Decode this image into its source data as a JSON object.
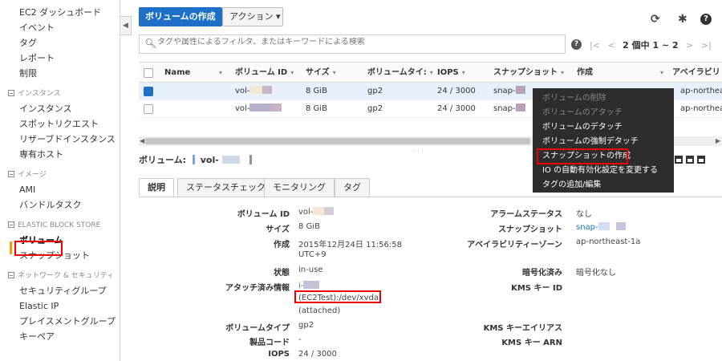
{
  "sidebar": {
    "items_top": [
      "EC2 ダッシュボード",
      "イベント",
      "タグ",
      "レポート",
      "制限"
    ],
    "sec_instances": "インスタンス",
    "items_instances": [
      "インスタンス",
      "スポットリクエスト",
      "リザーブドインスタンス",
      "専有ホスト"
    ],
    "sec_images": "イメージ",
    "items_images": [
      "AMI",
      "バンドルタスク"
    ],
    "sec_ebs": "ELASTIC BLOCK STORE",
    "items_ebs": [
      "ボリューム",
      "スナップショット"
    ],
    "sec_network": "ネットワーク & セキュリティ",
    "items_network": [
      "セキュリティグループ",
      "Elastic IP",
      "プレイスメントグループ",
      "キーペア"
    ]
  },
  "toolbar": {
    "create_label": "ボリュームの作成",
    "action_label": "アクション ▾"
  },
  "search": {
    "placeholder": "タグや属性によるフィルタ、またはキーワードによる検索"
  },
  "pager": {
    "text": "2 個中 1 ~ 2"
  },
  "table": {
    "headers": [
      "Name",
      "ボリューム ID",
      "サイズ",
      "ボリュームタイ:",
      "IOPS",
      "スナップショット",
      "作成",
      "アベイラビリ"
    ],
    "rows": [
      {
        "volume_id": "vol-",
        "size": "8 GiB",
        "type": "gp2",
        "iops": "24 / 3000",
        "snapshot": "snap-",
        "az": "ap-northeas",
        "selected": true
      },
      {
        "volume_id": "vol-",
        "size": "8 GiB",
        "type": "gp2",
        "iops": "24 / 3000",
        "snapshot": "snap-",
        "az": "ap-northeas",
        "selected": false
      }
    ]
  },
  "menu": {
    "items": [
      {
        "label": "ボリュームの削除",
        "enabled": false
      },
      {
        "label": "ボリュームのアタッチ",
        "enabled": false
      },
      {
        "label": "ボリュームのデタッチ",
        "enabled": true
      },
      {
        "label": "ボリュームの強制デタッチ",
        "enabled": true
      },
      {
        "label": "スナップショットの作成",
        "enabled": true
      },
      {
        "label": "IO の自動有効化設定を変更する",
        "enabled": true
      },
      {
        "label": "タグの追加/編集",
        "enabled": true
      }
    ]
  },
  "detail": {
    "header_label": "ボリューム:",
    "header_value": "vol-",
    "tabs": [
      "説明",
      "ステータスチェック",
      "モニタリング",
      "タグ"
    ],
    "left": {
      "volume_id_k": "ボリューム ID",
      "volume_id_v": "vol-",
      "size_k": "サイズ",
      "size_v": "8 GiB",
      "created_k": "作成",
      "created_v1": "2015年12月24日 11:56:58",
      "created_v2": "UTC+9",
      "state_k": "状態",
      "state_v": "in-use",
      "attach_k": "アタッチ済み情報",
      "attach_v1": "i-",
      "attach_v2": "(EC2Test):/dev/xvda",
      "attach_v3": "(attached)",
      "voltype_k": "ボリュームタイプ",
      "voltype_v": "gp2",
      "product_k": "製品コード",
      "product_v": "-",
      "iops_k": "IOPS",
      "iops_v": "24 / 3000"
    },
    "right": {
      "alarm_k": "アラームステータス",
      "alarm_v": "なし",
      "snap_k": "スナップショット",
      "snap_v": "snap-",
      "az_k": "アベイラビリティーゾーン",
      "az_v": "ap-northeast-1a",
      "enc_k": "暗号化済み",
      "enc_v": "暗号化なし",
      "kms_k": "KMS キー ID",
      "kms_alias_k": "KMS キーエイリアス",
      "kms_arn_k": "KMS キー ARN"
    }
  },
  "colors": {
    "primary": "#1d6fc8",
    "highlight": "#e00000",
    "selected_bar": "#ff9900",
    "menu_bg": "#2d2d2d"
  }
}
